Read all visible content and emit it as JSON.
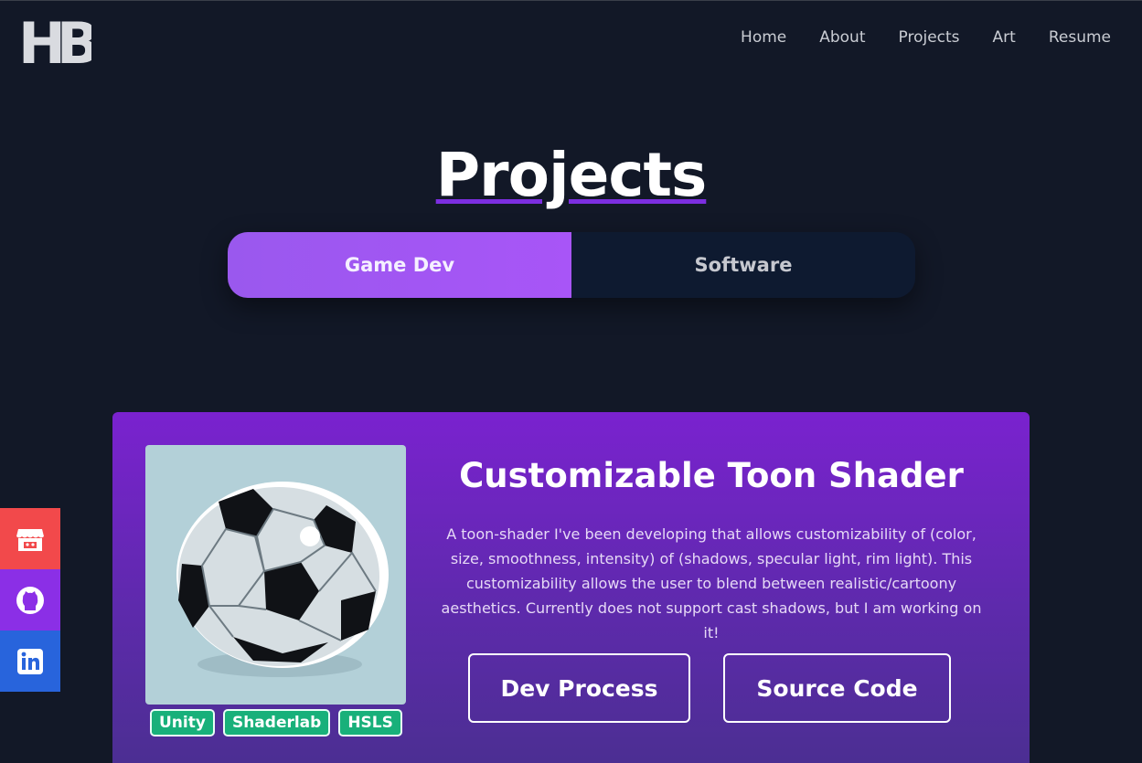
{
  "brand": {
    "logo_text": "HB"
  },
  "nav": {
    "home": "Home",
    "about": "About",
    "projects": "Projects",
    "art": "Art",
    "resume": "Resume"
  },
  "page_title": "Projects",
  "tabs": [
    {
      "label": "Game Dev",
      "active": true
    },
    {
      "label": "Software",
      "active": false
    }
  ],
  "social": [
    "itch-io-icon",
    "github-icon",
    "linkedin-icon"
  ],
  "project": {
    "title": "Customizable Toon Shader",
    "description": "A toon-shader I've been developing that allows customizability of (color, size, smoothness, intensity) of (shadows, specular light, rim light). This customizability allows the user to blend between realistic/cartoony aesthetics. Currently does not support cast shadows, but I am working on it!",
    "tags": [
      "Unity",
      "Shaderlab",
      "HSLS"
    ],
    "buttons": {
      "dev_process": "Dev Process",
      "source_code": "Source Code"
    }
  },
  "colors": {
    "background": "#121827",
    "accent": "#a855f7",
    "card": "#7a22cf",
    "tag": "#18b07a"
  }
}
